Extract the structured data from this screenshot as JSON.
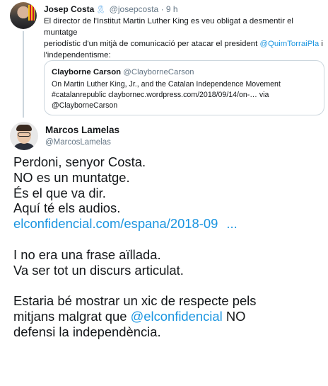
{
  "parent_tweet": {
    "author_name": "Josep Costa",
    "ribbon_icon": "yellow-ribbon-icon",
    "handle": "@josepcosta",
    "separator": "·",
    "time": "9 h",
    "text_line1": "El director de l'Institut Martin Luther King es veu obligat a desmentir el muntatge",
    "text_line2_prefix": "periodístic d'un mitjà de comunicació per atacar el president ",
    "text_line2_mention": "@QuimTorraiPla",
    "text_line2_suffix": " i",
    "text_line3": "l'independentisme:",
    "quote": {
      "author_name": "Clayborne Carson",
      "handle": "@ClayborneCarson",
      "line1": "On Martin Luther King, Jr., and the Catalan Independence Movement",
      "line2": "#catalanrepublic claybornec.wordpress.com/2018/09/14/on-… via",
      "line3": "@ClayborneCarson"
    }
  },
  "main_tweet": {
    "author_name": "Marcos Lamelas",
    "handle": "@MarcosLamelas",
    "lines": {
      "l1": "Perdoni, senyor Costa.",
      "l2": "NO es un muntatge.",
      "l3": "És el que va dir.",
      "l4": "Aquí té els audios.",
      "link": "elconfidencial.com/espana/2018-09",
      "link_ellipsis": "...",
      "l6": "I no era una frase aïllada.",
      "l7": "Va ser tot un discurs articulat.",
      "l9": "Estaria bé mostrar un xic de respecte pels",
      "l10_prefix": "mitjans malgrat que ",
      "l10_mention": "@elconfidencial",
      "l10_suffix": " NO",
      "l11": "defensi la independència."
    }
  },
  "colors": {
    "link": "#1b95e0",
    "text": "#14171a",
    "muted": "#657786",
    "border": "#ccd6dd"
  }
}
